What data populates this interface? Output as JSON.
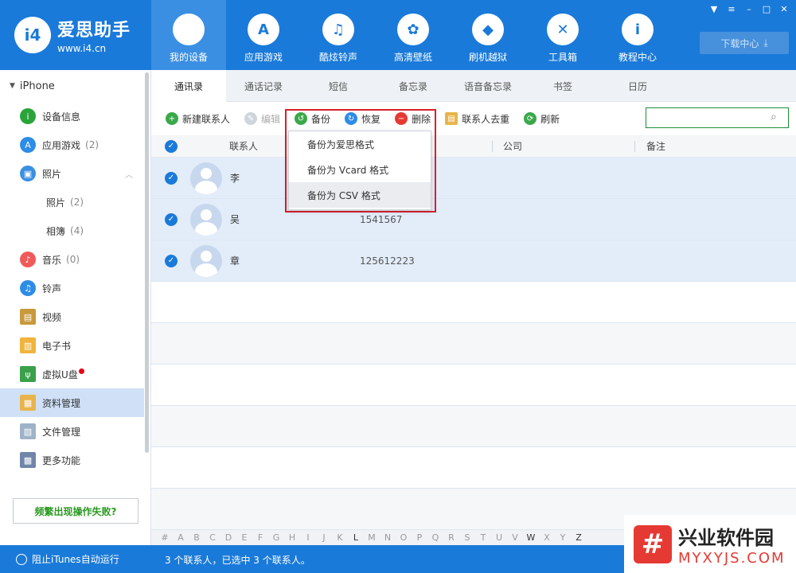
{
  "app": {
    "logo_badge": "i4",
    "logo_title": "爱思助手",
    "logo_url": "www.i4.cn"
  },
  "nav": [
    {
      "label": "我的设备",
      "icon": "apple-icon",
      "glyph": ""
    },
    {
      "label": "应用游戏",
      "icon": "app-store-icon",
      "glyph": "A"
    },
    {
      "label": "酷炫铃声",
      "icon": "bell-icon",
      "glyph": "♫"
    },
    {
      "label": "高清壁纸",
      "icon": "flower-icon",
      "glyph": "✿"
    },
    {
      "label": "刷机越狱",
      "icon": "dropbox-icon",
      "glyph": "◆"
    },
    {
      "label": "工具箱",
      "icon": "tools-icon",
      "glyph": "✕"
    },
    {
      "label": "教程中心",
      "icon": "info-icon",
      "glyph": "i"
    }
  ],
  "download_label": "下载中心",
  "sidebar": {
    "device": "iPhone",
    "items": [
      {
        "label": "设备信息",
        "count": "",
        "icon": "info-icon",
        "color": "#2aa43a",
        "glyph": "i"
      },
      {
        "label": "应用游戏",
        "count": "(2)",
        "icon": "app-store-icon",
        "color": "#2d8ce6",
        "glyph": "A"
      },
      {
        "label": "照片",
        "count": "",
        "icon": "photo-icon",
        "color": "#3b8fe3",
        "glyph": "▣"
      },
      {
        "label": "照片",
        "count": "(2)"
      },
      {
        "label": "相簿",
        "count": "(4)"
      },
      {
        "label": "音乐",
        "count": "(0)",
        "icon": "music-icon",
        "color": "#f05a5a",
        "glyph": "♪"
      },
      {
        "label": "铃声",
        "count": "",
        "icon": "bell-icon",
        "color": "#2d8ce6",
        "glyph": "♫"
      },
      {
        "label": "视频",
        "count": "",
        "icon": "video-icon",
        "color": "#c89a3c",
        "glyph": "▤"
      },
      {
        "label": "电子书",
        "count": "",
        "icon": "book-icon",
        "color": "#f0b43c",
        "glyph": "▥"
      },
      {
        "label": "虚拟U盘",
        "count": "",
        "icon": "usb-icon",
        "color": "#3aa04a",
        "glyph": "ψ"
      },
      {
        "label": "资料管理",
        "count": "",
        "icon": "contacts-file-icon",
        "color": "#e8b44a",
        "glyph": "▦"
      },
      {
        "label": "文件管理",
        "count": "",
        "icon": "file-icon",
        "color": "#9fb3c8",
        "glyph": "▧"
      },
      {
        "label": "更多功能",
        "count": "",
        "icon": "grid-icon",
        "color": "#6f86a8",
        "glyph": "▩"
      }
    ],
    "help_label": "频繁出现操作失败?"
  },
  "tabs": [
    "通讯录",
    "通话记录",
    "短信",
    "备忘录",
    "语音备忘录",
    "书签",
    "日历"
  ],
  "toolbar": {
    "new_contact": "新建联系人",
    "edit": "编辑",
    "backup": "备份",
    "restore": "恢复",
    "delete": "删除",
    "dedupe": "联系人去重",
    "refresh": "刷新"
  },
  "table": {
    "col_name": "联系人",
    "col_company": "公司",
    "col_note": "备注"
  },
  "contacts": [
    {
      "name": "李",
      "phone": ""
    },
    {
      "name": "吴",
      "phone": "1541567"
    },
    {
      "name": "章",
      "phone": "125612223"
    }
  ],
  "dropdown": [
    "备份为爱思格式",
    "备份为 Vcard 格式",
    "备份为 CSV 格式"
  ],
  "alphabet": [
    "#",
    "A",
    "B",
    "C",
    "D",
    "E",
    "F",
    "G",
    "H",
    "I",
    "J",
    "K",
    "L",
    "M",
    "N",
    "O",
    "P",
    "Q",
    "R",
    "S",
    "T",
    "U",
    "V",
    "W",
    "X",
    "Y",
    "Z"
  ],
  "alphabet_active": [
    "L",
    "W",
    "Z"
  ],
  "status": {
    "itunes": "阻止iTunes自动运行",
    "summary": "3 个联系人，已选中 3 个联系人。"
  },
  "watermark": {
    "mark": "#",
    "title": "兴业软件园",
    "url": "MYXYJS.COM"
  }
}
